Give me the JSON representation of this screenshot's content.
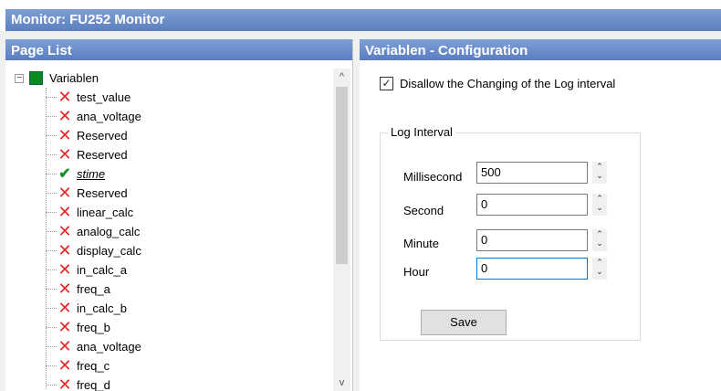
{
  "window": {
    "title": "Monitor: FU252 Monitor"
  },
  "page_list": {
    "header": "Page List",
    "root": {
      "label": "Variablen",
      "expander": "−",
      "icon": "green-square-icon"
    },
    "items": [
      {
        "label": "test_value",
        "status": "error"
      },
      {
        "label": "ana_voltage",
        "status": "error"
      },
      {
        "label": "Reserved",
        "status": "error"
      },
      {
        "label": "Reserved",
        "status": "error"
      },
      {
        "label": "stime",
        "status": "ok"
      },
      {
        "label": "Reserved",
        "status": "error"
      },
      {
        "label": "linear_calc",
        "status": "error"
      },
      {
        "label": "analog_calc",
        "status": "error"
      },
      {
        "label": "display_calc",
        "status": "error"
      },
      {
        "label": "in_calc_a",
        "status": "error"
      },
      {
        "label": "freq_a",
        "status": "error"
      },
      {
        "label": "in_calc_b",
        "status": "error"
      },
      {
        "label": "freq_b",
        "status": "error"
      },
      {
        "label": "ana_voltage",
        "status": "error"
      },
      {
        "label": "freq_c",
        "status": "error"
      },
      {
        "label": "freq_d",
        "status": "error"
      }
    ],
    "scroll_up": "^",
    "scroll_down": "v"
  },
  "config": {
    "header": "Variablen - Configuration",
    "disallow_label": "Disallow the Changing of the Log interval",
    "disallow_checked": true,
    "group_title": "Log Interval",
    "fields": [
      {
        "label": "Millisecond",
        "value": "500"
      },
      {
        "label": "Second",
        "value": "0"
      },
      {
        "label": "Minute",
        "value": "0"
      },
      {
        "label": "Hour",
        "value": "0"
      }
    ],
    "save_label": "Save"
  },
  "colors": {
    "header_blue": "#5b7fc0",
    "error_red": "#e32a2a",
    "ok_green": "#1a8c2a",
    "root_green": "#0a8a1f"
  }
}
